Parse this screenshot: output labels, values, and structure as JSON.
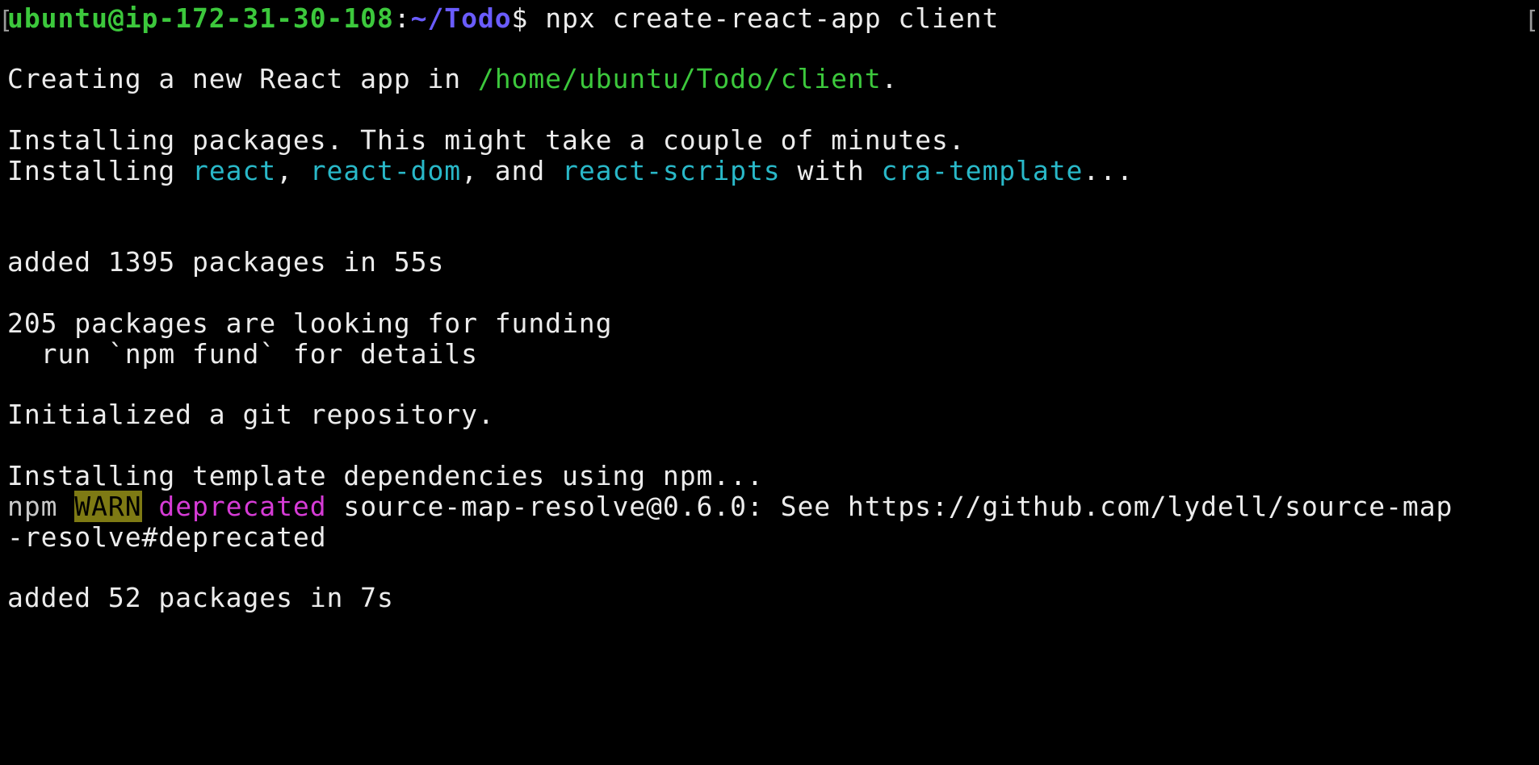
{
  "prompt": {
    "user_host": "ubuntu@ip-172-31-30-108",
    "separator": ":",
    "path": "~/Todo",
    "dollar": "$",
    "command": " npx create-react-app client"
  },
  "lines": {
    "creating_prefix": "Creating a new React app in ",
    "creating_path": "/home/ubuntu/Todo/client",
    "creating_suffix": ".",
    "installing_packages": "Installing packages. This might take a couple of minutes.",
    "installing_prefix": "Installing ",
    "pkg_react": "react",
    "comma1": ", ",
    "pkg_react_dom": "react-dom",
    "and_text": ", and ",
    "pkg_react_scripts": "react-scripts",
    "with_text": " with ",
    "pkg_cra_template": "cra-template",
    "ellipsis": "...",
    "added_1395": "added 1395 packages in 55s",
    "funding": "205 packages are looking for funding",
    "fund_hint": "  run `npm fund` for details",
    "git_init": "Initialized a git repository.",
    "template_deps": "Installing template dependencies using npm...",
    "npm_label": "npm ",
    "warn_label": "WARN",
    "deprecated_label": " deprecated",
    "deprecated_msg": " source-map-resolve@0.6.0: See https://github.com/lydell/source-map",
    "deprecated_cont": "-resolve#deprecated",
    "added_52": "added 52 packages in 7s"
  },
  "colors": {
    "background": "#000000",
    "text": "#ECECEC",
    "green": "#3CC83C",
    "path_blue": "#6A5CFF",
    "cyan": "#29B8C8",
    "magenta": "#D63BD6",
    "warn_bg": "#7E7A14"
  }
}
